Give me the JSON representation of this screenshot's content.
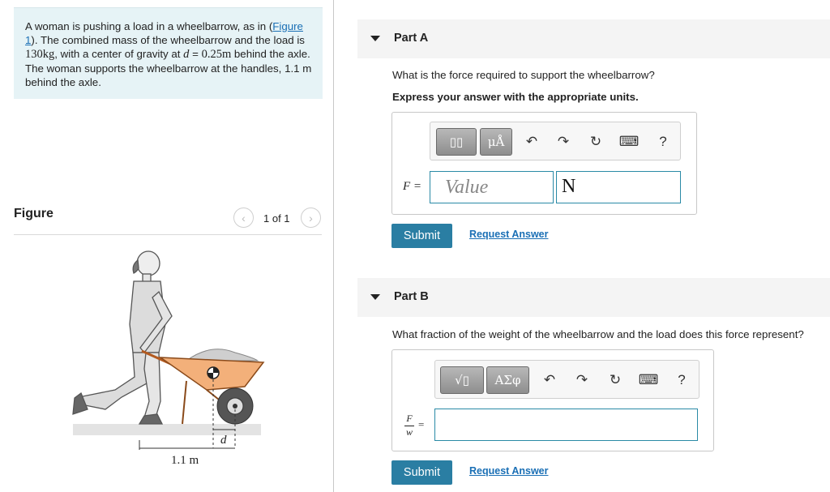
{
  "problem": {
    "text_1": "A woman is pushing a load in a wheelbarrow, as in (",
    "figure_link": "Figure 1",
    "text_2": "). The combined mass of the wheelbarrow and the load is ",
    "mass": "130kg",
    "text_3": ", with a center of gravity at ",
    "d_var": "d",
    "text_4": " = ",
    "d_value": "0.25m",
    "text_5": " behind the axle. The woman supports the wheelbarrow at the handles, ",
    "handle_dist": "1.1 m",
    "text_6": " behind the axle."
  },
  "figure": {
    "label": "Figure",
    "prev_icon": "chevron-left-icon",
    "next_icon": "chevron-right-icon",
    "page_count": "1 of 1",
    "dim_d": "d",
    "dim_handle": "1.1 m"
  },
  "part_a": {
    "label": "Part A",
    "question": "What is the force required to support the wheelbarrow?",
    "instruction": "Express your answer with the appropriate units.",
    "toolbar": {
      "templates": "▯▯",
      "units": "μÅ",
      "undo": "↶",
      "redo": "↷",
      "reset": "↻",
      "keyboard": "⌨",
      "help": "?"
    },
    "var_label": "F =",
    "value_placeholder": "Value",
    "unit_value": "N",
    "submit": "Submit",
    "request": "Request Answer"
  },
  "part_b": {
    "label": "Part B",
    "question": "What fraction of the weight of the wheelbarrow and the load does this force represent?",
    "toolbar": {
      "sqrt": "√▯",
      "greek": "ΑΣφ",
      "undo": "↶",
      "redo": "↷",
      "reset": "↻",
      "keyboard": "⌨",
      "help": "?"
    },
    "frac_num": "F",
    "frac_den": "w",
    "eq": "=",
    "submit": "Submit",
    "request": "Request Answer"
  }
}
